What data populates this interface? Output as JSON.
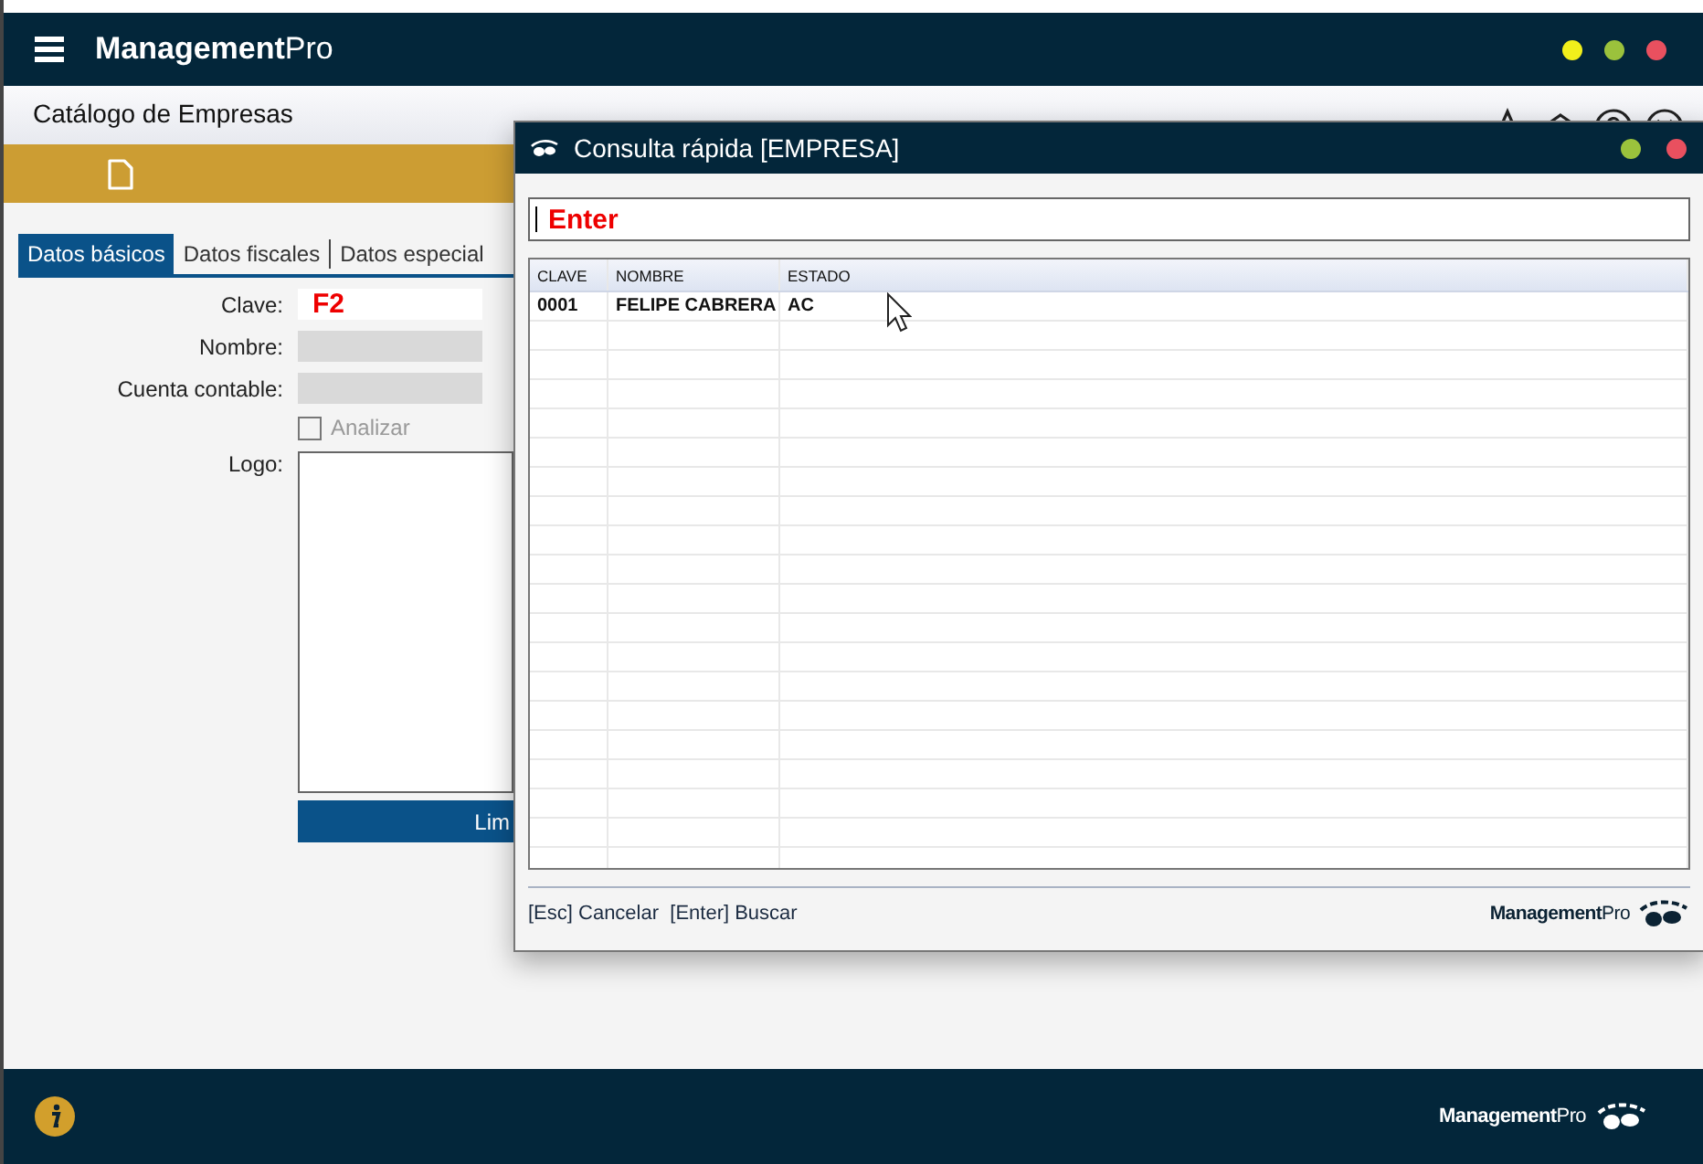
{
  "app": {
    "brand": "**Management**Pro"
  },
  "page": {
    "title": "Catálogo de Empresas"
  },
  "tabs": [
    {
      "label": "Datos básicos",
      "selected": true
    },
    {
      "label": "Datos fiscales",
      "selected": false
    },
    {
      "label": "Datos especial",
      "selected": false
    }
  ],
  "form": {
    "fields": [
      {
        "kind": "text",
        "label": "Clave:",
        "value": "F2",
        "disabled": false
      },
      {
        "kind": "text",
        "label": "Nombre:",
        "disabled": true
      },
      {
        "kind": "text",
        "label": "Cuenta contable:",
        "disabled": true
      },
      {
        "kind": "checkbox",
        "label": "Analizar",
        "checked": false,
        "disabled": true
      },
      {
        "kind": "image",
        "label": "Logo:"
      }
    ],
    "button": "Lim"
  },
  "dialog": {
    "title": "Consulta rápida [EMPRESA]",
    "search": {
      "value": "Enter"
    },
    "table": {
      "columns": [
        "CLAVE",
        "NOMBRE",
        "ESTADO"
      ],
      "rows": [
        [
          "0001",
          "FELIPE CABRERA",
          "AC"
        ]
      ]
    },
    "hints": "[Esc] Cancelar  [Enter] Buscar",
    "brand": "**Management**Pro"
  },
  "footer": {
    "brand": "**Management**Pro"
  }
}
